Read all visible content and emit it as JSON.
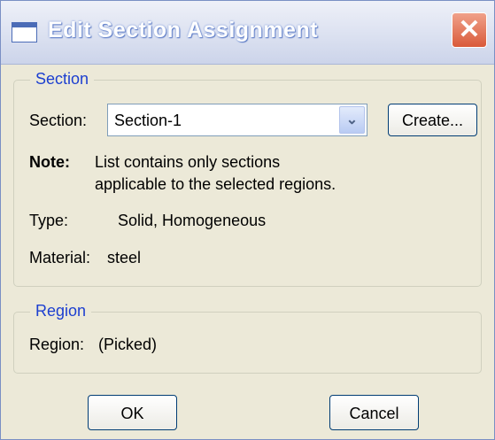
{
  "window": {
    "title": "Edit Section Assignment",
    "close_label": "✕"
  },
  "section_group": {
    "legend": "Section",
    "section_label": "Section:",
    "section_value": "Section-1",
    "create_label": "Create...",
    "note_label": "Note:",
    "note_line1": "List contains only sections",
    "note_line2": "applicable to the selected regions.",
    "type_label": "Type:",
    "type_value": "Solid, Homogeneous",
    "material_label": "Material:",
    "material_value": "steel"
  },
  "region_group": {
    "legend": "Region",
    "region_label": "Region:",
    "region_value": "(Picked)"
  },
  "buttons": {
    "ok": "OK",
    "cancel": "Cancel"
  },
  "icons": {
    "window": "window-icon",
    "close": "close-icon",
    "dropdown": "chevron-down-icon"
  }
}
